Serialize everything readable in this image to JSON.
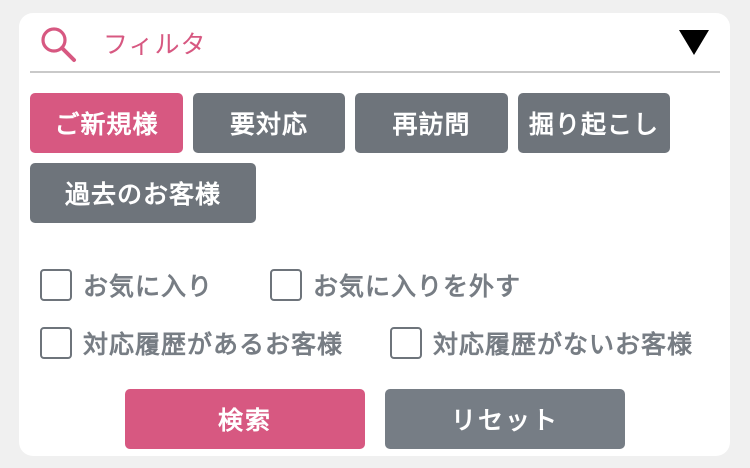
{
  "filter": {
    "label": "フィルタ",
    "search_icon": "search-icon",
    "toggle_icon": "triangle-down-icon"
  },
  "tags": [
    {
      "label": "ご新規様",
      "active": true
    },
    {
      "label": "要対応",
      "active": false
    },
    {
      "label": "再訪問",
      "active": false
    },
    {
      "label": "掘り起こし",
      "active": false
    },
    {
      "label": "過去のお客様",
      "active": false
    }
  ],
  "checkboxes": [
    {
      "label": "お気に入り",
      "checked": false
    },
    {
      "label": "お気に入りを外す",
      "checked": false
    },
    {
      "label": "対応履歴があるお客様",
      "checked": false
    },
    {
      "label": "対応履歴がないお客様",
      "checked": false
    }
  ],
  "actions": {
    "search_label": "検索",
    "reset_label": "リセット"
  },
  "colors": {
    "accent": "#d75881",
    "tag_gray": "#6e747b",
    "reset_gray": "#767d85",
    "text_gray": "#777d84"
  }
}
